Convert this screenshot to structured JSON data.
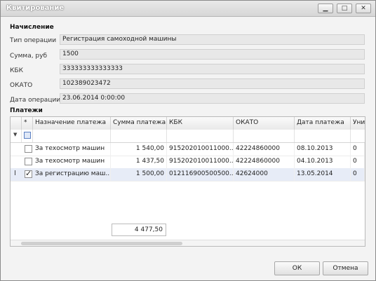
{
  "window": {
    "title": "Квитирование",
    "min_glyph": "▁",
    "max_glyph": "□",
    "close_glyph": "✕"
  },
  "charge": {
    "section_title": "Начисление",
    "fields": [
      {
        "label": "Тип операции",
        "value": "Регистрация самоходной машины"
      },
      {
        "label": "Сумма, руб",
        "value": "1500"
      },
      {
        "label": "КБК",
        "value": "333333333333333"
      },
      {
        "label": "ОКАТО",
        "value": "102389023472"
      },
      {
        "label": "Дата операции",
        "value": "23.06.2014 0:00:00"
      }
    ]
  },
  "payments": {
    "section_title": "Платежи",
    "columns": [
      "*",
      "Назначение платежа",
      "Сумма платежа",
      "КБК",
      "ОКАТО",
      "Дата платежа",
      "Уник"
    ],
    "filter_icon": "▼",
    "rows": [
      {
        "checked": false,
        "purpose": "За техосмотр машин",
        "amount": "1 540,00",
        "kbk": "915202010011000...",
        "okato": "42224860000",
        "date": "08.10.2013",
        "unique": "0"
      },
      {
        "checked": false,
        "purpose": "За техосмотр машин",
        "amount": "1 437,50",
        "kbk": "915202010011000...",
        "okato": "42224860000",
        "date": "04.10.2013",
        "unique": "0"
      },
      {
        "checked": true,
        "purpose": "За регистрацию маш...",
        "amount": "1 500,00",
        "kbk": "012116900500500...",
        "okato": "42624000",
        "date": "13.05.2014",
        "unique": "0"
      }
    ],
    "row_cursor": "I",
    "total": "4 477,50"
  },
  "buttons": {
    "ok": "ОК",
    "cancel": "Отмена"
  }
}
